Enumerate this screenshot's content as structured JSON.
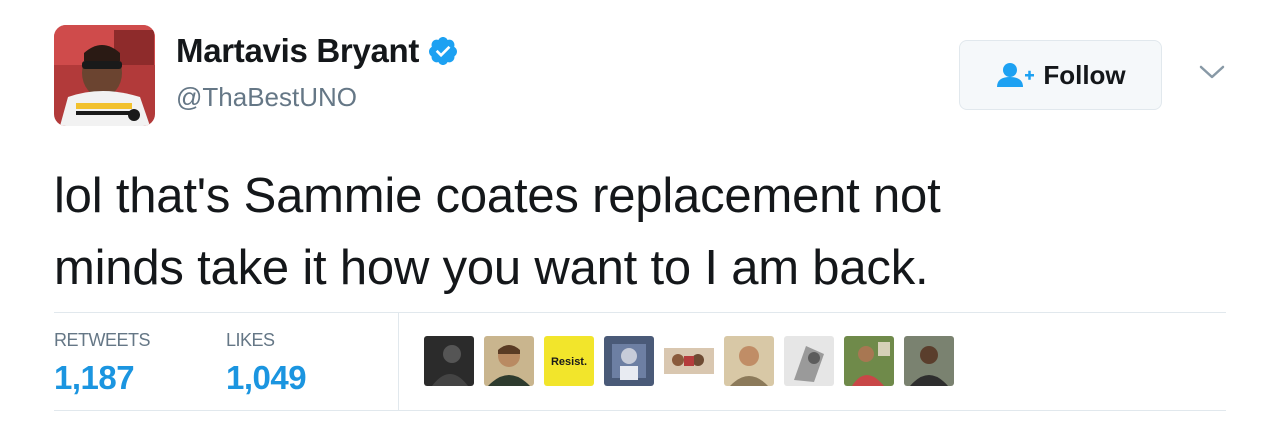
{
  "author": {
    "display_name": "Martavis Bryant",
    "handle": "@ThaBestUNO",
    "verified": true,
    "avatar_icon": "user-avatar-photo"
  },
  "follow_button": {
    "label": "Follow",
    "icon": "add-user-icon"
  },
  "menu_caret_icon": "chevron-down-icon",
  "tweet": {
    "text_line1": "lol that's Sammie coates replacement not",
    "text_line2": "minds take it how you want to I am back."
  },
  "stats": {
    "retweets_label": "RETWEETS",
    "retweets_value": "1,187",
    "likes_label": "LIKES",
    "likes_value": "1,049"
  },
  "likers": {
    "resist_badge_text": "Resist."
  },
  "colors": {
    "verified_blue": "#1da1f2",
    "stat_value_blue": "#1b95e0",
    "muted_gray": "#657786",
    "border_gray": "#e1e8ed"
  }
}
